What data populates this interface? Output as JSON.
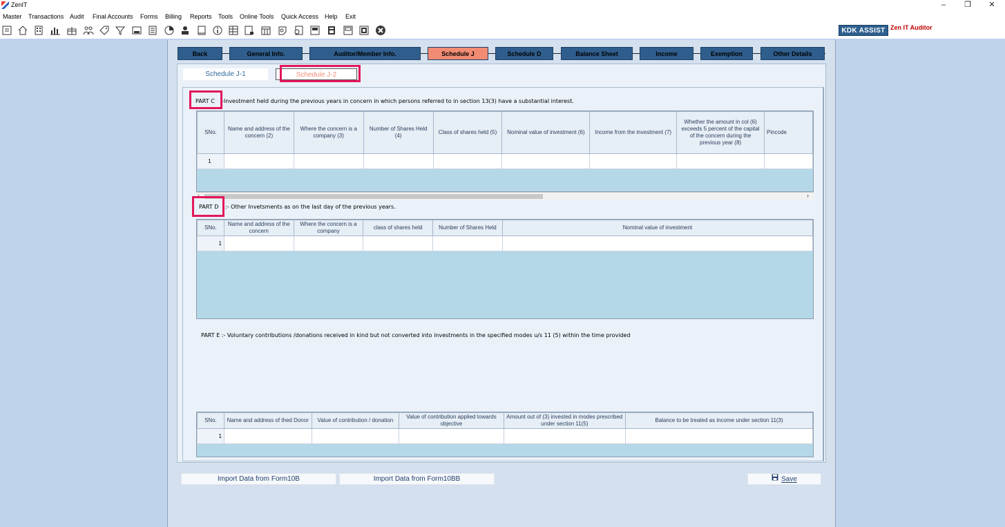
{
  "window": {
    "title": "ZenIT",
    "controls": [
      "–",
      "❐",
      "✕"
    ]
  },
  "menu": [
    "Master",
    "Transactions",
    "Audit",
    "Final Accounts",
    "Forms",
    "Billing",
    "Reports",
    "Tools",
    "Online Tools",
    "Quick Access",
    "Help",
    "Exit"
  ],
  "toolbar": {
    "icons": [
      "report-icon",
      "home-icon",
      "building-icon",
      "bar-chart-icon",
      "gift-icon",
      "people-icon",
      "tag-icon",
      "filter-icon",
      "tax-icon",
      "calculator-icon",
      "pie-icon",
      "bank-icon",
      "document-icon",
      "info-icon",
      "spreadsheet-icon",
      "chart-doc-icon",
      "calendar-icon",
      "notebook-icon",
      "form-icon",
      "bb-icon",
      "printer-icon",
      "scd-icon",
      "export-icon",
      "close-circle-icon"
    ],
    "kdk_assist": "KDK ASSIST",
    "zen_it_auditor": "Zen IT Auditor"
  },
  "nav_tabs": [
    {
      "label": "Back",
      "active": false
    },
    {
      "label": "General Info.",
      "active": false
    },
    {
      "label": "Auditor/Member Info.",
      "active": false
    },
    {
      "label": "Schedule J",
      "active": true
    },
    {
      "label": "Schedule D",
      "active": false
    },
    {
      "label": "Balance Sheet",
      "active": false
    },
    {
      "label": "Income",
      "active": false
    },
    {
      "label": "Exemption",
      "active": false
    },
    {
      "label": "Other Details",
      "active": false
    }
  ],
  "sub_tabs": [
    {
      "label": "Schedule J-1",
      "active": false
    },
    {
      "label": "Schedule J-2",
      "active": true
    }
  ],
  "part_c": {
    "marker": "PART C",
    "description": "-Investment held during the previous years in concern in which persons referred to in section 13(3) have a  substantial interest.",
    "columns": [
      "SNo.",
      "Name and address of the concern   (2)",
      "Where the concern is a company   (3)",
      "Number of Shares Held (4)",
      "Class of shares held (5)",
      "Nominal value of investment (6)",
      "Income from the investment (7)",
      "Whether the amount in col (6) exceeds 5 percent of the capital of the concern during the previous year (8)",
      "Pincode"
    ],
    "rows": [
      [
        "1",
        "",
        "",
        "",
        "",
        "",
        "",
        "",
        ""
      ]
    ]
  },
  "part_d": {
    "marker": "PART D",
    "description": ":- Other Invetsments as on the last day of the previous years.",
    "columns": [
      "SNo.",
      "Name and address of the concern",
      "Where the concern is a company",
      "class of shares held",
      "Number of Shares Held",
      "Nominal value of investment"
    ],
    "rows": [
      [
        "1",
        "",
        "",
        "",
        "",
        ""
      ]
    ]
  },
  "part_e": {
    "description": "PART E :- Voluntary contributions /donations received in kind but not converted into investments in the specified modes u/s 11 (5) within the time provided",
    "columns": [
      "SNo.",
      "Name and address of thed Donor",
      "Value of contribution / donation",
      "Value of contribution applied towards objective",
      "Amount out of (3) invested in modes prescribed under section 11(5)",
      "Balance to be treated as income under section 11(3)"
    ],
    "rows": [
      [
        "1",
        "",
        "",
        "",
        "",
        ""
      ]
    ]
  },
  "buttons": {
    "import_10b": "Import Data from Form10B",
    "import_10bb": "Import Data from Form10BB",
    "save": "Save"
  }
}
